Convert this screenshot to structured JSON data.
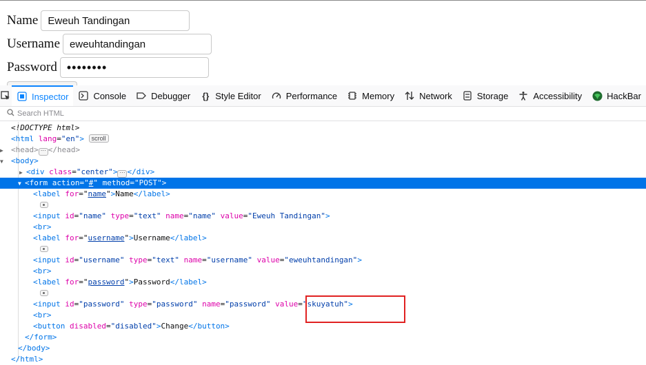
{
  "page": {
    "name_label": "Name",
    "name_value": "Eweuh Tandingan",
    "username_label": "Username",
    "username_value": "eweuhtandingan",
    "password_label": "Password",
    "password_value": "skuyatuh"
  },
  "toolbar": {
    "tabs": [
      {
        "label": "Inspector",
        "icon": "inspector-icon"
      },
      {
        "label": "Console",
        "icon": "console-icon"
      },
      {
        "label": "Debugger",
        "icon": "debugger-icon"
      },
      {
        "label": "Style Editor",
        "icon": "style-editor-icon"
      },
      {
        "label": "Performance",
        "icon": "performance-icon"
      },
      {
        "label": "Memory",
        "icon": "memory-icon"
      },
      {
        "label": "Network",
        "icon": "network-icon"
      },
      {
        "label": "Storage",
        "icon": "storage-icon"
      },
      {
        "label": "Accessibility",
        "icon": "accessibility-icon"
      },
      {
        "label": "HackBar",
        "icon": "hackbar-icon"
      }
    ],
    "active_tab": "Inspector"
  },
  "search": {
    "placeholder": "Search HTML"
  },
  "markup": {
    "doctype": "<!DOCTYPE html>",
    "html_lang": "\"en\"",
    "scroll_badge": "scroll",
    "div_class": "\"center\"",
    "form_action": "#",
    "form_method": "\"POST\"",
    "label_name_for": "name",
    "label_name_text": "Name",
    "input_name_id": "\"name\"",
    "input_name_type": "\"text\"",
    "input_name_name": "\"name\"",
    "input_name_value": "\"Eweuh Tandingan\"",
    "label_username_for": "username",
    "label_username_text": "Username",
    "input_username_id": "\"username\"",
    "input_username_type": "\"text\"",
    "input_username_name": "\"username\"",
    "input_username_value": "\"eweuhtandingan\"",
    "label_password_for": "password",
    "label_password_text": "Password",
    "input_password_id": "\"password\"",
    "input_password_type": "\"password\"",
    "input_password_name": "\"password\"",
    "input_password_value": "\"skuyatuh\"",
    "button_disabled": "\"disabled\"",
    "button_text": "Change"
  },
  "colors": {
    "accent": "#0a84ff",
    "selection": "#0074e8",
    "highlight_box": "#e02020"
  }
}
